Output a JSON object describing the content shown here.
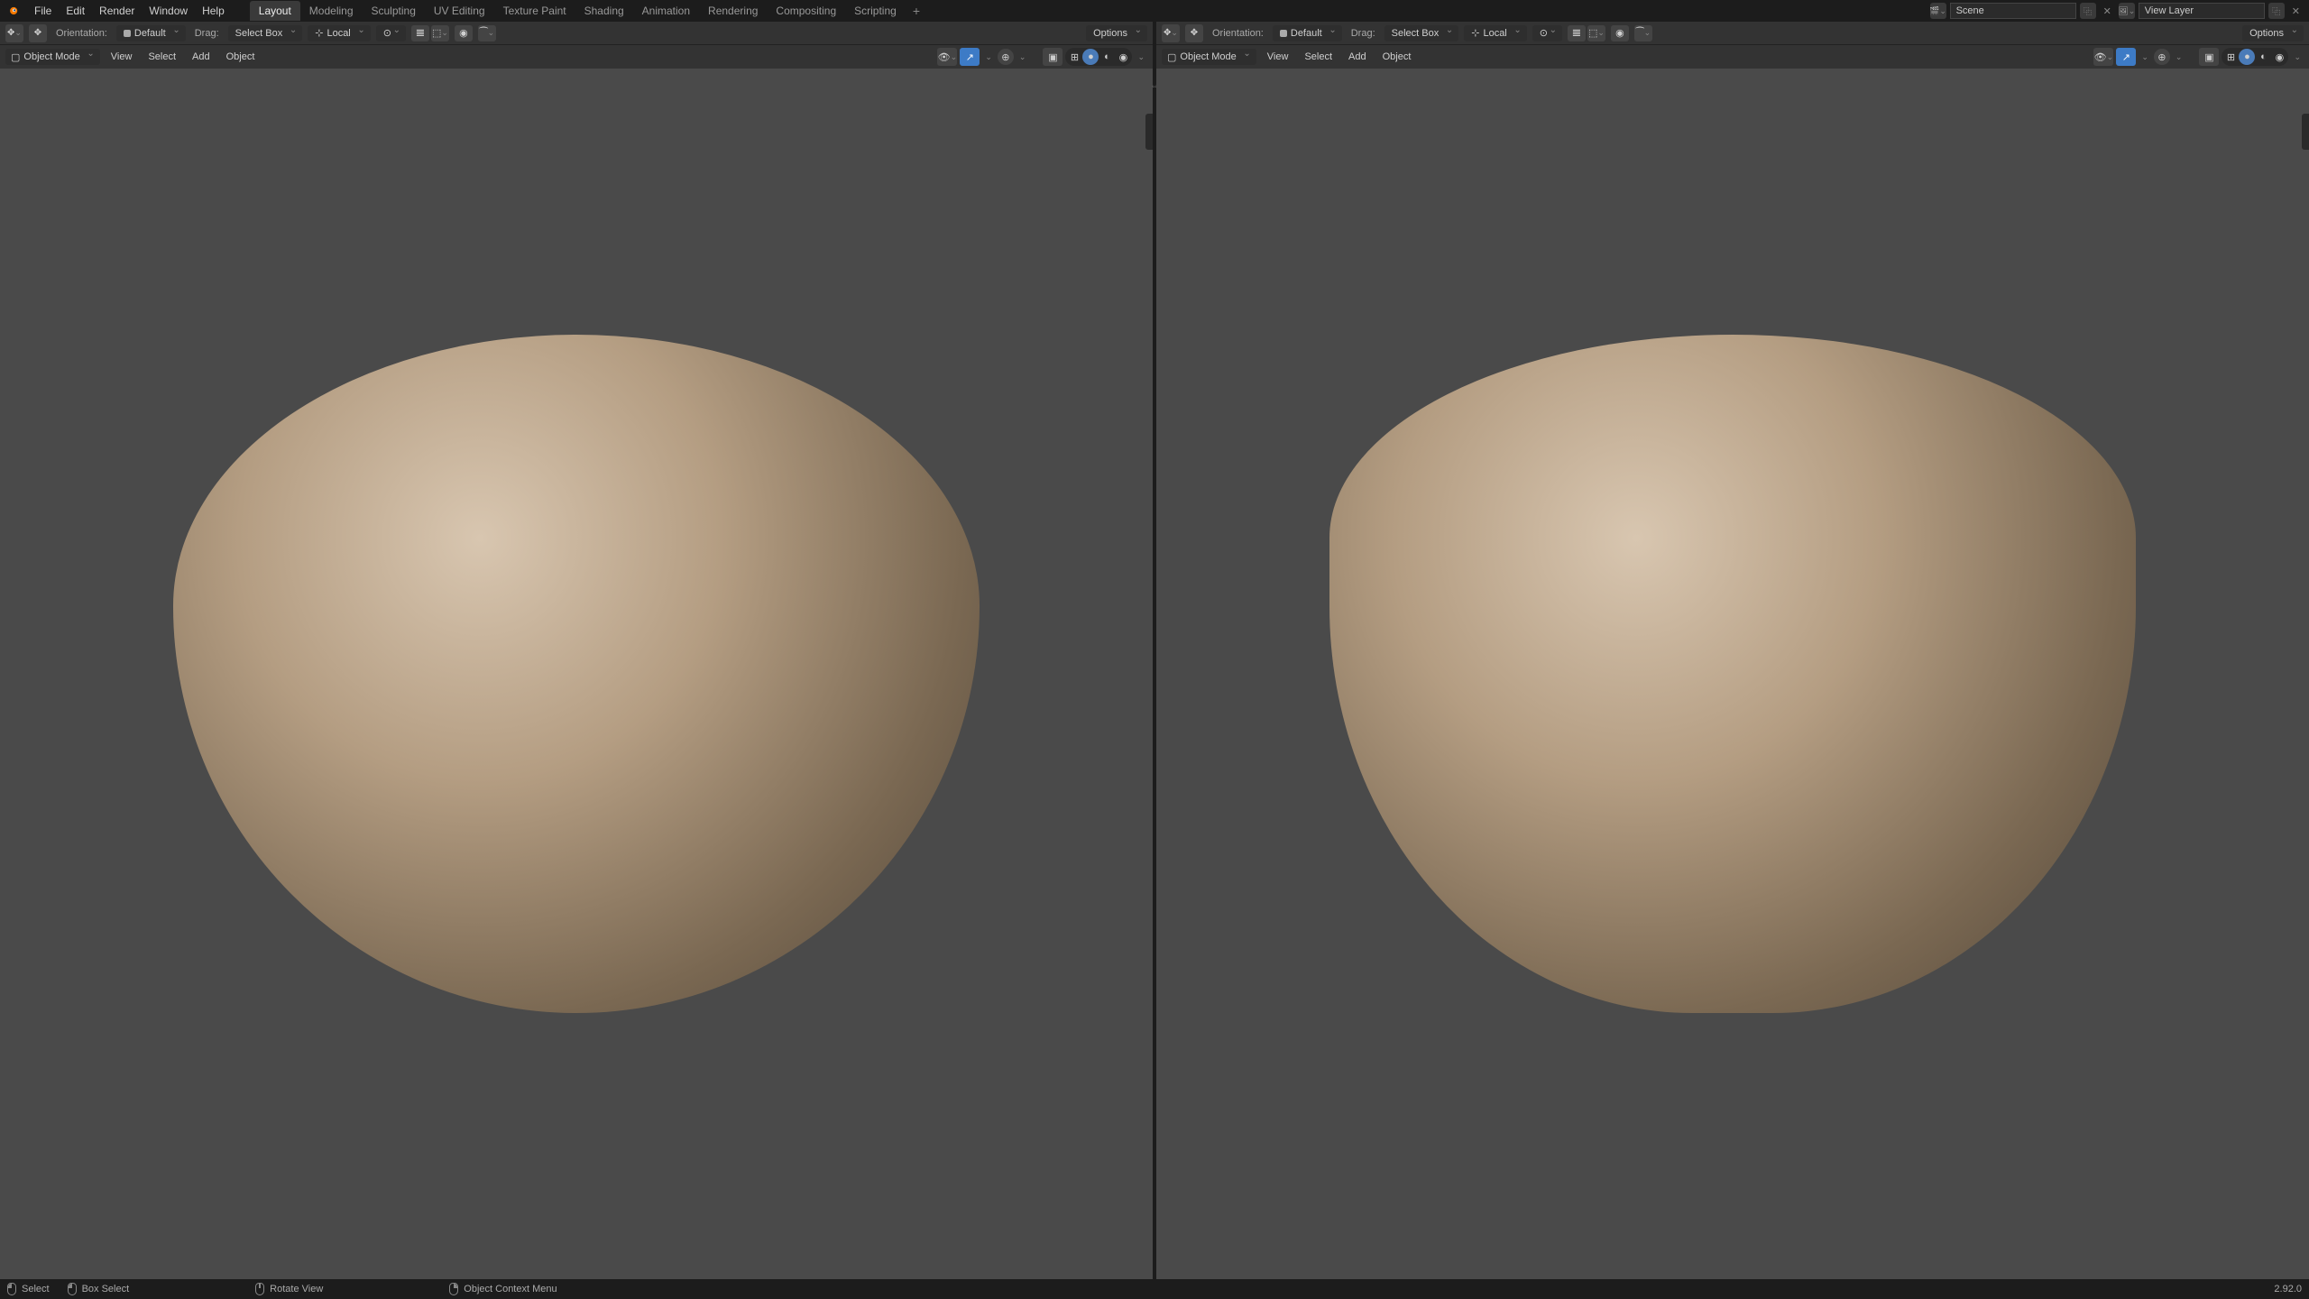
{
  "menubar": {
    "menus": [
      "File",
      "Edit",
      "Render",
      "Window",
      "Help"
    ],
    "workspaces": [
      "Layout",
      "Modeling",
      "Sculpting",
      "UV Editing",
      "Texture Paint",
      "Shading",
      "Animation",
      "Rendering",
      "Compositing",
      "Scripting"
    ],
    "active_workspace": "Layout",
    "scene": "Scene",
    "view_layer": "View Layer"
  },
  "tool_header": {
    "orientation_label": "Orientation:",
    "orientation_value": "Default",
    "drag_label": "Drag:",
    "drag_value": "Select Box",
    "transform_value": "Local",
    "options_label": "Options"
  },
  "viewport_header": {
    "mode": "Object Mode",
    "menus": [
      "View",
      "Select",
      "Add",
      "Object"
    ]
  },
  "status_bar": {
    "items": [
      {
        "icon": "l",
        "label": "Select"
      },
      {
        "icon": "l",
        "label": "Box Select"
      },
      {
        "icon": "m",
        "label": "Rotate View"
      },
      {
        "icon": "r",
        "label": "Object Context Menu"
      }
    ],
    "version": "2.92.0"
  },
  "colors": {
    "accent": "#3d7bc6",
    "bg_dark": "#1c1c1c",
    "bg_panel": "#333333",
    "bg_view": "#4a4a4a"
  }
}
